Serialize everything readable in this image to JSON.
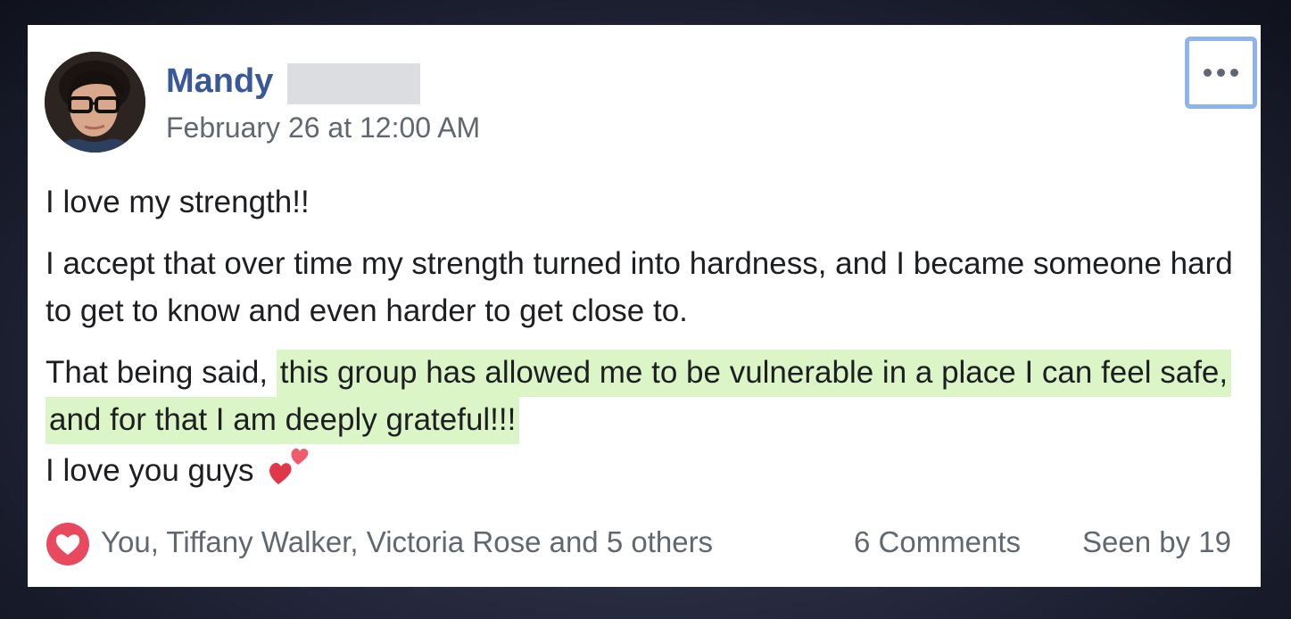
{
  "post": {
    "author_first_name": "Mandy",
    "timestamp": "February 26 at 12:00 AM",
    "menu_icon": "more-options-icon",
    "paragraphs": {
      "p1": "I love my strength!!",
      "p2": "I accept that over time my strength turned into hardness, and I became someone hard to get to know and even harder to get close to.",
      "p3_lead": "That being said, ",
      "p3_highlight": "this group has allowed me to be vulnerable in a place I can feel safe, and for that I am deeply grateful!!!",
      "p3_end": "I love you guys"
    },
    "highlight_color": "#dcf5c6"
  },
  "footer": {
    "reaction_icon": "love-reaction-icon",
    "reactors": "You, Tiffany Walker, Victoria Rose and 5 others",
    "comments": "6 Comments",
    "seen": "Seen by 19"
  },
  "colors": {
    "author_link": "#385898",
    "secondary_text": "#606770",
    "focus_ring": "#8fb3f0"
  }
}
